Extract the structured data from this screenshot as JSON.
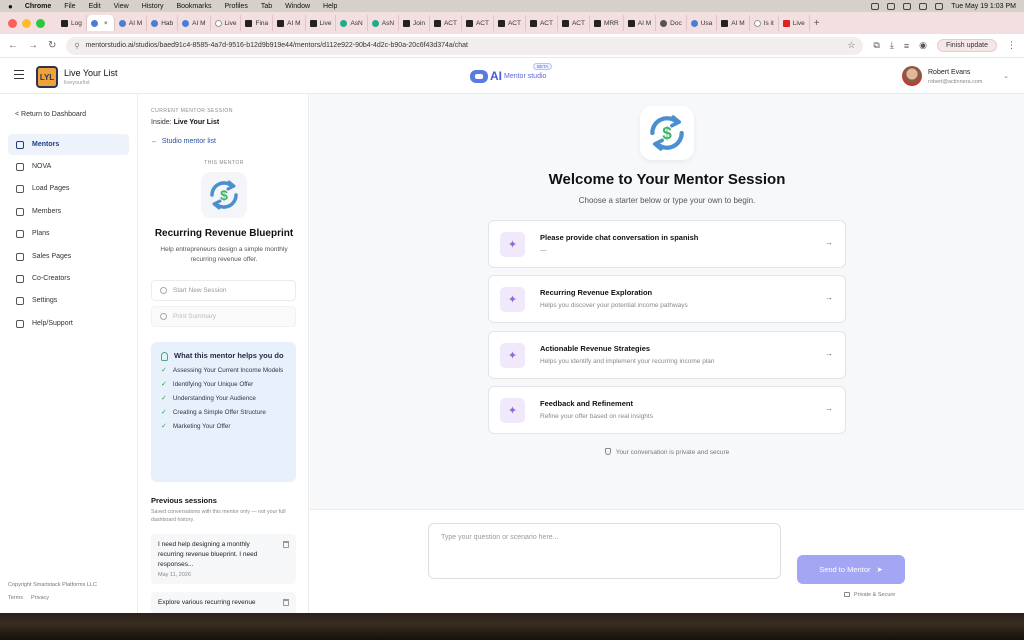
{
  "menubar": {
    "items": [
      "Chrome",
      "File",
      "Edit",
      "View",
      "History",
      "Bookmarks",
      "Profiles",
      "Tab",
      "Window",
      "Help"
    ],
    "datetime": "Tue May 19  1:03 PM"
  },
  "tabs": [
    "Log",
    "",
    "AI M",
    "Hab",
    "AI M",
    "Live",
    "Fina",
    "AI M",
    "Live",
    "AsN",
    "AsN",
    "Join",
    "ACT",
    "ACT",
    "ACT",
    "ACT",
    "ACT",
    "MRR",
    "AI M",
    "Doc",
    "Usa",
    "AI M",
    "Is it",
    "Live"
  ],
  "browser": {
    "url": "mentorstudio.ai/studios/baed91c4-8585-4a7d-9516-b12d9b919e44/mentors/d112e922-90b4-4d2c-b90a-20c6f43d374a/chat",
    "update_label": "Finish update"
  },
  "header": {
    "app_name": "Live Your List",
    "app_sub": "liveyourlist",
    "brand_text": "AI",
    "brand_sub": "Mentor studio",
    "brand_badge": "BETA",
    "user_name": "Robert Evans",
    "user_email": "robert@actinnera.com"
  },
  "leftnav": {
    "return_label": "< Return to Dashboard",
    "items": [
      {
        "label": "Mentors",
        "icon": "briefcase-icon",
        "active": true
      },
      {
        "label": "NOVA",
        "icon": "sparkle-icon"
      },
      {
        "label": "Load Pages",
        "icon": "page-icon"
      },
      {
        "label": "Members",
        "icon": "users-icon"
      },
      {
        "label": "Plans",
        "icon": "plans-icon"
      },
      {
        "label": "Sales Pages",
        "icon": "cart-icon"
      },
      {
        "label": "Co-Creators",
        "icon": "user-plus-icon"
      },
      {
        "label": "Settings",
        "icon": "gear-icon"
      },
      {
        "label": "Help/Support",
        "icon": "help-icon"
      }
    ],
    "copyright": "Copyright Smartstack Platforms LLC",
    "terms": "Terms",
    "privacy": "Privacy"
  },
  "mentor_panel": {
    "current_label": "CURRENT MENTOR SESSION",
    "inside_prefix": "Inside:",
    "inside_name": "Live Your List",
    "back_label": "Studio mentor list",
    "this_mentor": "THIS MENTOR",
    "title": "Recurring Revenue Blueprint",
    "description": "Help entrepreneurs design a simple monthly recurring revenue offer.",
    "start_label": "Start New Session",
    "print_label": "Print Summary",
    "helps_title": "What this mentor helps you do",
    "helps_items": [
      "Assessing Your Current Income Models",
      "Identifying Your Unique Offer",
      "Understanding Your Audience",
      "Creating a Simple Offer Structure",
      "Marketing Your Offer"
    ],
    "prev_title": "Previous sessions",
    "prev_note": "Saved conversations with this mentor only — not your full dashboard history.",
    "sessions": [
      {
        "text": "I need help designing a monthly recurring revenue blueprint. I need responses...",
        "date": "May 11, 2026"
      },
      {
        "text": "Explore various recurring revenue",
        "date": ""
      }
    ]
  },
  "main": {
    "welcome": "Welcome to Your Mentor Session",
    "welcome_sub": "Choose a starter below or type your own to begin.",
    "starters": [
      {
        "title": "Please provide chat conversation in spanish",
        "sub": "—"
      },
      {
        "title": "Recurring Revenue Exploration",
        "sub": "Helps you discover your potential income pathways"
      },
      {
        "title": "Actionable Revenue Strategies",
        "sub": "Helps you identify and implement your recurring income plan"
      },
      {
        "title": "Feedback and Refinement",
        "sub": "Refine your offer based on real insights"
      }
    ],
    "private_note": "Your conversation is private and secure",
    "input_placeholder": "Type your question or scenario here...",
    "send_label": "Send to Mentor",
    "secure_note": "Private & Secure"
  },
  "colors": {
    "accent": "#1c3f86",
    "send_button": "#a3a6f3",
    "helps_bg": "#e8f0fb",
    "starter_icon_bg": "#efe9fb"
  }
}
